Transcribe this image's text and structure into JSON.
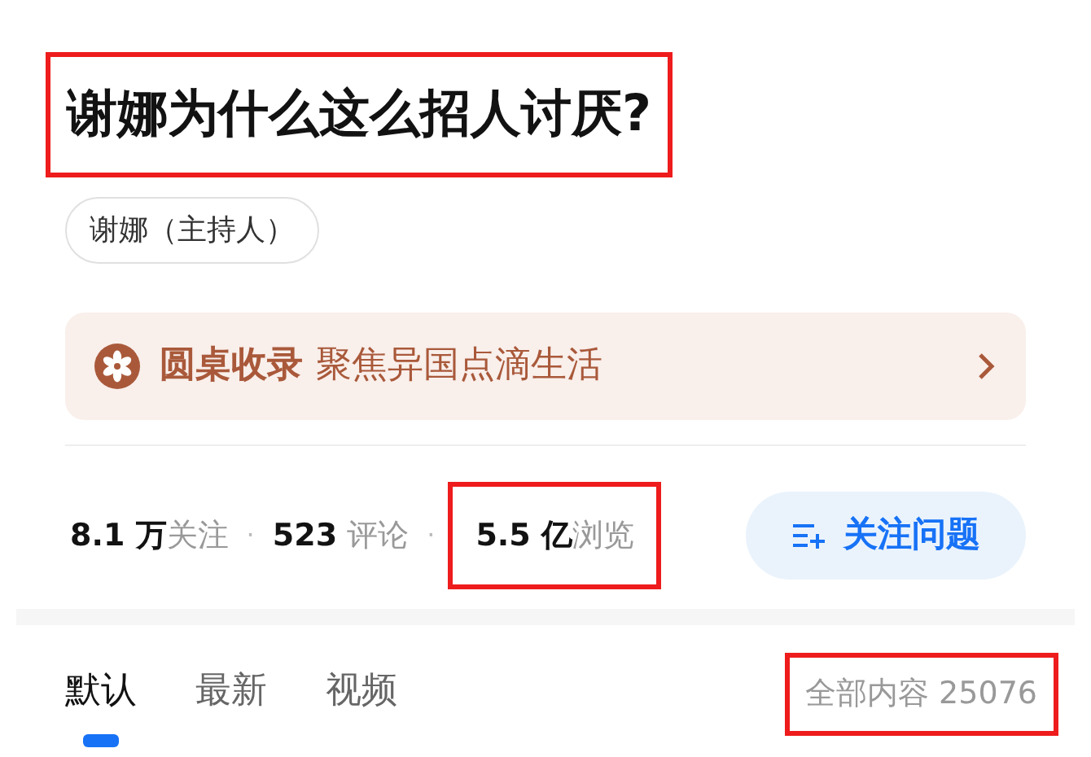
{
  "question": {
    "title": "谢娜为什么这么招人讨厌?",
    "highlighted": true
  },
  "topics": [
    {
      "label": "谢娜（主持人）"
    }
  ],
  "banner": {
    "name": "圆桌收录",
    "description": "聚焦异国点滴生活"
  },
  "stat_separator": "·",
  "stats": [
    {
      "text": "**8.1 万**关注",
      "highlighted": false
    },
    {
      "text": "**523** 评论",
      "highlighted": false
    },
    {
      "text": "**5.5 亿**浏览",
      "highlighted": true
    }
  ],
  "follow_button": {
    "label": "关注问题"
  },
  "tabs": [
    {
      "label": "默认",
      "selected": true
    },
    {
      "label": "最新",
      "selected": false
    },
    {
      "label": "视频",
      "selected": false
    }
  ],
  "total": {
    "text": "全部内容 25076",
    "highlighted": true
  }
}
